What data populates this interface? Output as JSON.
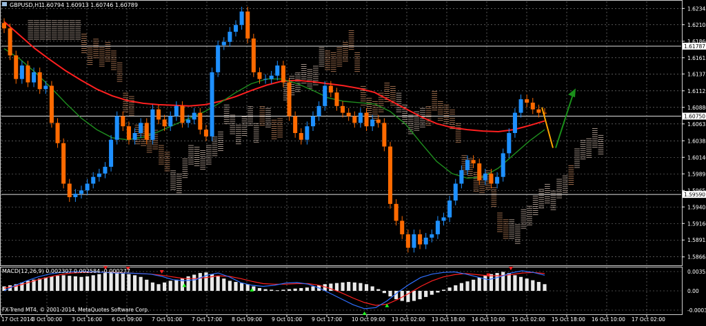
{
  "window": {
    "symbol_label": "GBPUSD,H1",
    "quote_line": "1.60794 1.60913 1.60746 1.60789",
    "copyright": "FX-Trend MT4, © 2001-2014, MetaQuotes Software Corp."
  },
  "chart_data": [
    {
      "type": "candlestick",
      "title": "GBPUSD,H1",
      "symbol": "GBPUSD",
      "timeframe": "H1",
      "ohlc_last": {
        "open": 1.60794,
        "high": 1.60913,
        "low": 1.60746,
        "close": 1.60789
      },
      "ylim": [
        1.5855,
        1.6245
      ],
      "y_ticks": [
        "1.62345",
        "1.62105",
        "1.61860",
        "1.61615",
        "1.61375",
        "1.61125",
        "1.60880",
        "1.60635",
        "1.60385",
        "1.60140",
        "1.59895",
        "1.59650",
        "1.59405",
        "1.59160",
        "1.58915",
        "1.58665"
      ],
      "price_levels": [
        {
          "label": "1.61787",
          "value": 1.61787
        },
        {
          "label": "1.60750",
          "value": 1.6075
        },
        {
          "label": "1.59590",
          "value": 1.5959
        }
      ],
      "x_ticks": [
        "17 Oct 2014",
        "3 Oct 00:00",
        "3 Oct 16:00",
        "6 Oct 09:00",
        "7 Oct 01:00",
        "7 Oct 17:00",
        "8 Oct 09:00",
        "9 Oct 01:00",
        "9 Oct 17:00",
        "10 Oct 09:00",
        "13 Oct 02:00",
        "13 Oct 18:00",
        "14 Oct 10:00",
        "15 Oct 02:00",
        "15 Oct 18:00",
        "16 Oct 10:00",
        "17 Oct 02:00"
      ],
      "close_path": [
        1.6205,
        1.6165,
        1.613,
        1.615,
        1.6125,
        1.614,
        1.6115,
        1.612,
        1.6065,
        1.6035,
        1.5975,
        1.5955,
        1.596,
        1.5965,
        1.5975,
        1.5985,
        1.599,
        1.6,
        1.604,
        1.6075,
        1.606,
        1.604,
        1.605,
        1.6065,
        1.604,
        1.6085,
        1.607,
        1.606,
        1.6075,
        1.609,
        1.6065,
        1.607,
        1.608,
        1.6055,
        1.6045,
        1.614,
        1.618,
        1.6185,
        1.62,
        1.621,
        1.623,
        1.619,
        1.614,
        1.613,
        1.613,
        1.6135,
        1.615,
        1.6125,
        1.6075,
        1.605,
        1.604,
        1.606,
        1.6075,
        1.609,
        1.612,
        1.611,
        1.609,
        1.608,
        1.6075,
        1.6065,
        1.608,
        1.606,
        1.607,
        1.6065,
        1.603,
        1.5945,
        1.592,
        1.59,
        1.588,
        1.59,
        1.5885,
        1.5895,
        1.59,
        1.592,
        1.5925,
        1.595,
        1.5975,
        1.5995,
        1.601,
        1.6005,
        1.598,
        1.599,
        1.5975,
        1.5985,
        1.602,
        1.605,
        1.608,
        1.61,
        1.6095,
        1.6085,
        1.608,
        1.6079
      ],
      "moving_averages": [
        {
          "color": "#ff2020",
          "values": [
            1.6215,
            1.6195,
            1.6175,
            1.6158,
            1.6142,
            1.6128,
            1.6115,
            1.6105,
            1.6098,
            1.6094,
            1.6092,
            1.6091,
            1.609,
            1.6092,
            1.6097,
            1.6104,
            1.6113,
            1.6121,
            1.6127,
            1.6128,
            1.6126,
            1.6123,
            1.612,
            1.6116,
            1.611,
            1.6098,
            1.6086,
            1.6074,
            1.6064,
            1.6058,
            1.6055,
            1.6053,
            1.6052,
            1.6055,
            1.6061,
            1.6068
          ]
        },
        {
          "color": "#1f8f1f",
          "values": [
            1.6175,
            1.616,
            1.614,
            1.6118,
            1.6094,
            1.6072,
            1.6055,
            1.6043,
            1.604,
            1.6044,
            1.6052,
            1.6062,
            1.6072,
            1.6082,
            1.6095,
            1.611,
            1.6123,
            1.613,
            1.613,
            1.6123,
            1.6113,
            1.6102,
            1.6097,
            1.6095,
            1.6093,
            1.6082,
            1.6063,
            1.6035,
            1.6008,
            1.599,
            1.5983,
            1.5985,
            1.5998,
            1.6018,
            1.6038,
            1.6055
          ]
        }
      ],
      "annotation_arrows": [
        {
          "color": "#ffa500",
          "from": 1.6088,
          "to": 1.6028
        },
        {
          "color": "#1a8f1a",
          "from": 1.6028,
          "to": 1.611
        }
      ],
      "grid": true
    },
    {
      "type": "histogram",
      "title": "MACD(12,26,9) 0.002307 0.002584 -0.000277",
      "name": "MACD(12,26,9)",
      "values_label": "0.002307 0.002584 -0.000277",
      "macd": 0.002307,
      "signal": 0.002584,
      "histogram": -0.000277,
      "y_ticks": [
        "0.003537",
        "0.00",
        "-0.000352"
      ],
      "ylim": [
        -0.0042,
        0.0042
      ],
      "histogram_values": [
        0.0008,
        0.001,
        0.0012,
        0.0015,
        0.0018,
        0.002,
        0.0022,
        0.0024,
        0.0026,
        0.0027,
        0.0028,
        0.0027,
        0.0026,
        0.0025,
        0.0026,
        0.0028,
        0.003,
        0.0032,
        0.0034,
        0.0033,
        0.0031,
        0.003,
        0.0028,
        0.0025,
        0.002,
        0.0015,
        0.0012,
        0.0015,
        0.0018,
        0.002,
        0.0022,
        0.0026,
        0.0029,
        0.0032,
        0.0033,
        0.003,
        0.0026,
        0.0022,
        0.0018,
        0.0016,
        0.0014,
        0.0012,
        0.0008,
        0.0005,
        0.0003,
        0.0002,
        0.0001,
        0.0002,
        0.0003,
        0.0004,
        0.0005,
        0.0006,
        0.0008,
        0.001,
        0.0012,
        0.0013,
        0.0014,
        0.0015,
        0.0016,
        0.0015,
        0.0014,
        0.0012,
        0.0008,
        0.0003,
        -0.0004,
        -0.001,
        -0.0015,
        -0.0018,
        -0.002,
        -0.0018,
        -0.0015,
        -0.0011,
        -0.0007,
        -0.0003,
        0.0002,
        0.0006,
        0.001,
        0.0014,
        0.0017,
        0.002,
        0.0024,
        0.0027,
        0.003,
        0.0032,
        0.0034,
        0.0032,
        0.0028,
        0.0025,
        0.0022,
        0.0019,
        0.0016,
        0.0012
      ],
      "macd_line": [
        0.0,
        0.001,
        0.0018,
        0.0025,
        0.003,
        0.0033,
        0.0034,
        0.0035,
        0.0034,
        0.0033,
        0.0032,
        0.0032,
        0.0031,
        0.003,
        0.0026,
        0.002,
        0.0018,
        0.002,
        0.0028,
        0.0032,
        0.0025,
        0.0015,
        0.001,
        0.0008,
        0.001,
        0.0014,
        0.0015,
        0.0012,
        0.0005,
        -0.0005,
        -0.0015,
        -0.0025,
        -0.0032,
        -0.003,
        -0.0018,
        -0.0002,
        0.0012,
        0.0024,
        0.003,
        0.0033,
        0.0034,
        0.003,
        0.0025,
        0.002,
        0.0025,
        0.0032,
        0.0036,
        0.0033,
        0.0028
      ],
      "signal_line": [
        0.0005,
        0.0008,
        0.0014,
        0.002,
        0.0025,
        0.0029,
        0.0032,
        0.0033,
        0.0034,
        0.0033,
        0.0033,
        0.0032,
        0.0031,
        0.003,
        0.0028,
        0.0025,
        0.0022,
        0.0022,
        0.0024,
        0.0027,
        0.0026,
        0.0022,
        0.0017,
        0.0013,
        0.0012,
        0.0012,
        0.0013,
        0.0013,
        0.001,
        0.0004,
        -0.0004,
        -0.0013,
        -0.0021,
        -0.0026,
        -0.0024,
        -0.0015,
        -0.0004,
        0.0008,
        0.0018,
        0.0025,
        0.0029,
        0.0031,
        0.0029,
        0.0027,
        0.0027,
        0.0029,
        0.0032,
        0.0033,
        0.0031
      ],
      "markers": [
        {
          "index": 9,
          "dir": "down",
          "color": "#ff2020"
        },
        {
          "index": 11,
          "dir": "down",
          "color": "#ff2020"
        },
        {
          "index": 14,
          "dir": "down",
          "color": "#ff2020"
        },
        {
          "index": 16,
          "dir": "up",
          "color": "#20ff20"
        },
        {
          "index": 22,
          "dir": "up",
          "color": "#20ff20"
        },
        {
          "index": 32,
          "dir": "up",
          "color": "#20ff20"
        },
        {
          "index": 34,
          "dir": "up",
          "color": "#20ff20"
        },
        {
          "index": 43,
          "dir": "down",
          "color": "#ff2020"
        },
        {
          "index": 45,
          "dir": "down",
          "color": "#ff2020"
        }
      ],
      "grid": true
    }
  ],
  "colors": {
    "background": "#000000",
    "grid": "#c8c8c8",
    "bull_candle": "#1e90ff",
    "bear_candle": "#ff6a00",
    "text": "#ffffff",
    "cloud_bull": "#f0d8c8",
    "cloud_bear": "#e8a070"
  }
}
